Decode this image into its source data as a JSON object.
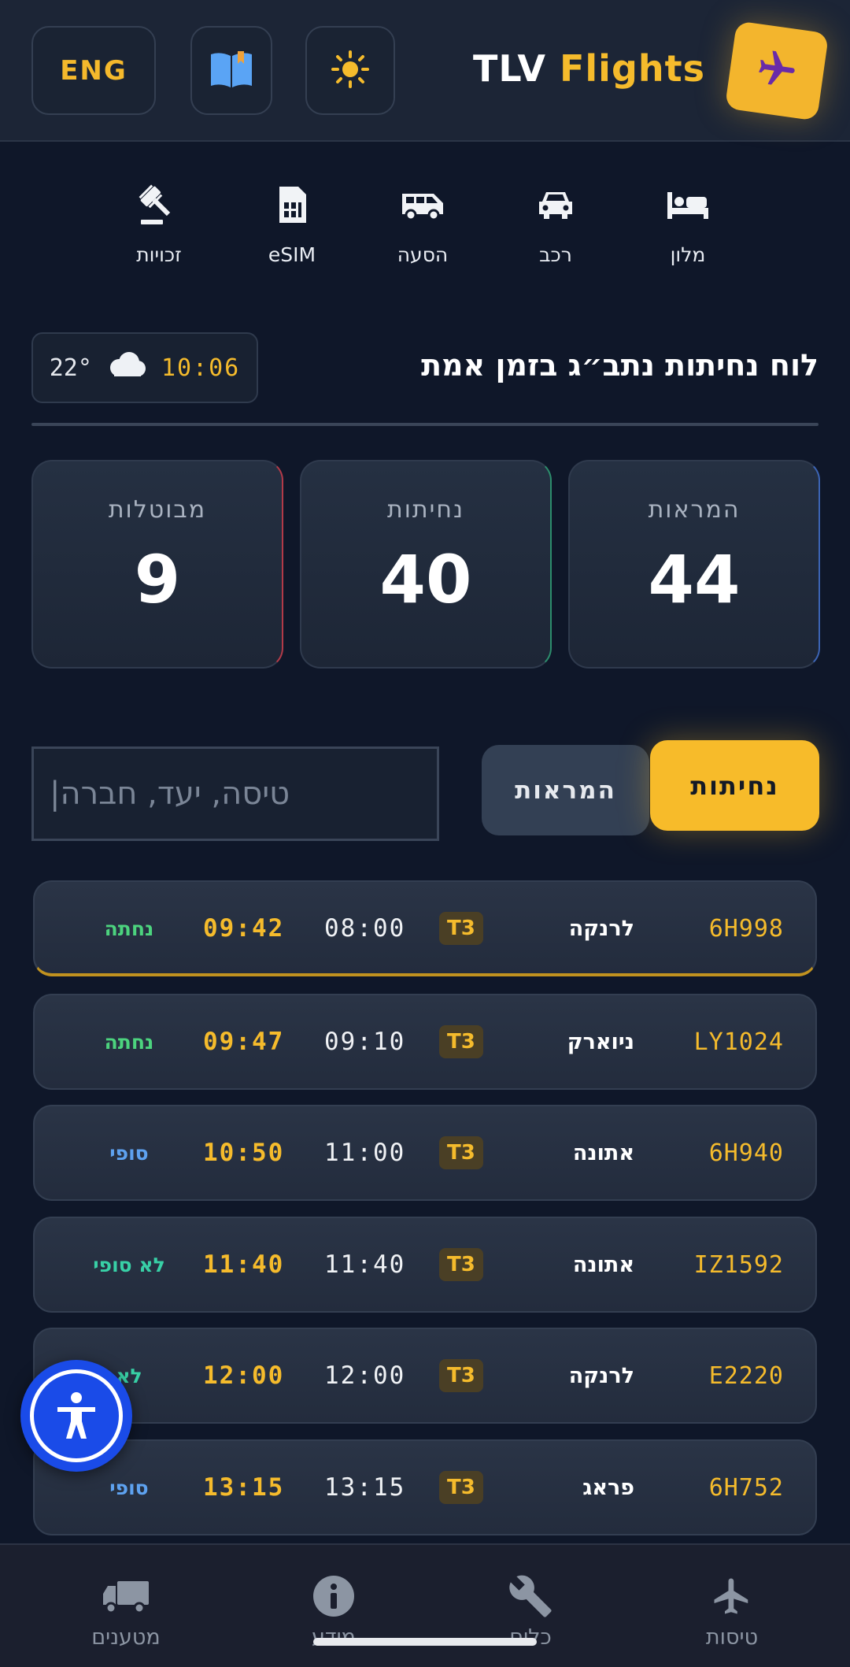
{
  "header": {
    "lang_button": "ENG",
    "brand_prefix": "TLV",
    "brand_accent": "Flights",
    "icons": [
      "book-icon",
      "sun-icon",
      "airplane-icon"
    ]
  },
  "services": [
    {
      "label": "מלון",
      "icon": "bed-icon"
    },
    {
      "label": "רכב",
      "icon": "car-icon"
    },
    {
      "label": "הסעה",
      "icon": "shuttle-icon"
    },
    {
      "label": "eSIM",
      "icon": "sim-card-icon"
    },
    {
      "label": "זכויות",
      "icon": "gavel-icon"
    }
  ],
  "board": {
    "title": "לוח נחיתות נתב״ג בזמן אמת",
    "time": "10:06",
    "temperature": "22°"
  },
  "stats": {
    "departures": {
      "label": "המראות",
      "value": "44"
    },
    "landings": {
      "label": "נחיתות",
      "value": "40"
    },
    "cancelled": {
      "label": "מבוטלות",
      "value": "9"
    }
  },
  "tabs": {
    "landings": "נחיתות",
    "departures": "המראות"
  },
  "search": {
    "placeholder": "טיסה, יעד, חברה"
  },
  "flights": [
    {
      "flight": "6H998",
      "destination": "לרנקה",
      "terminal": "T3",
      "scheduled": "08:00",
      "estimated": "09:42",
      "status": "נחתה",
      "status_color": "#4cd37e"
    },
    {
      "flight": "LY1024",
      "destination": "ניוארק",
      "terminal": "T3",
      "scheduled": "09:10",
      "estimated": "09:47",
      "status": "נחתה",
      "status_color": "#4cd37e"
    },
    {
      "flight": "6H940",
      "destination": "אתונה",
      "terminal": "T3",
      "scheduled": "11:00",
      "estimated": "10:50",
      "status": "סופי",
      "status_color": "#5ea2f0"
    },
    {
      "flight": "IZ1592",
      "destination": "אתונה",
      "terminal": "T3",
      "scheduled": "11:40",
      "estimated": "11:40",
      "status": "לא סופי",
      "status_color": "#38d0a6"
    },
    {
      "flight": "E2220",
      "destination": "לרנקה",
      "terminal": "T3",
      "scheduled": "12:00",
      "estimated": "12:00",
      "status": "לא",
      "status_color": "#38d0a6"
    },
    {
      "flight": "6H752",
      "destination": "פראג",
      "terminal": "T3",
      "scheduled": "13:15",
      "estimated": "13:15",
      "status": "סופי",
      "status_color": "#5ea2f0"
    }
  ],
  "bottom_nav": [
    {
      "label": "טיסות",
      "icon": "airplane-icon"
    },
    {
      "label": "כלים",
      "icon": "wrench-icon"
    },
    {
      "label": "מידע",
      "icon": "info-icon"
    },
    {
      "label": "מטענים",
      "icon": "truck-icon"
    }
  ],
  "colors": {
    "accent": "#f5bb2c",
    "background": "#0f1729",
    "card": "#253042"
  }
}
